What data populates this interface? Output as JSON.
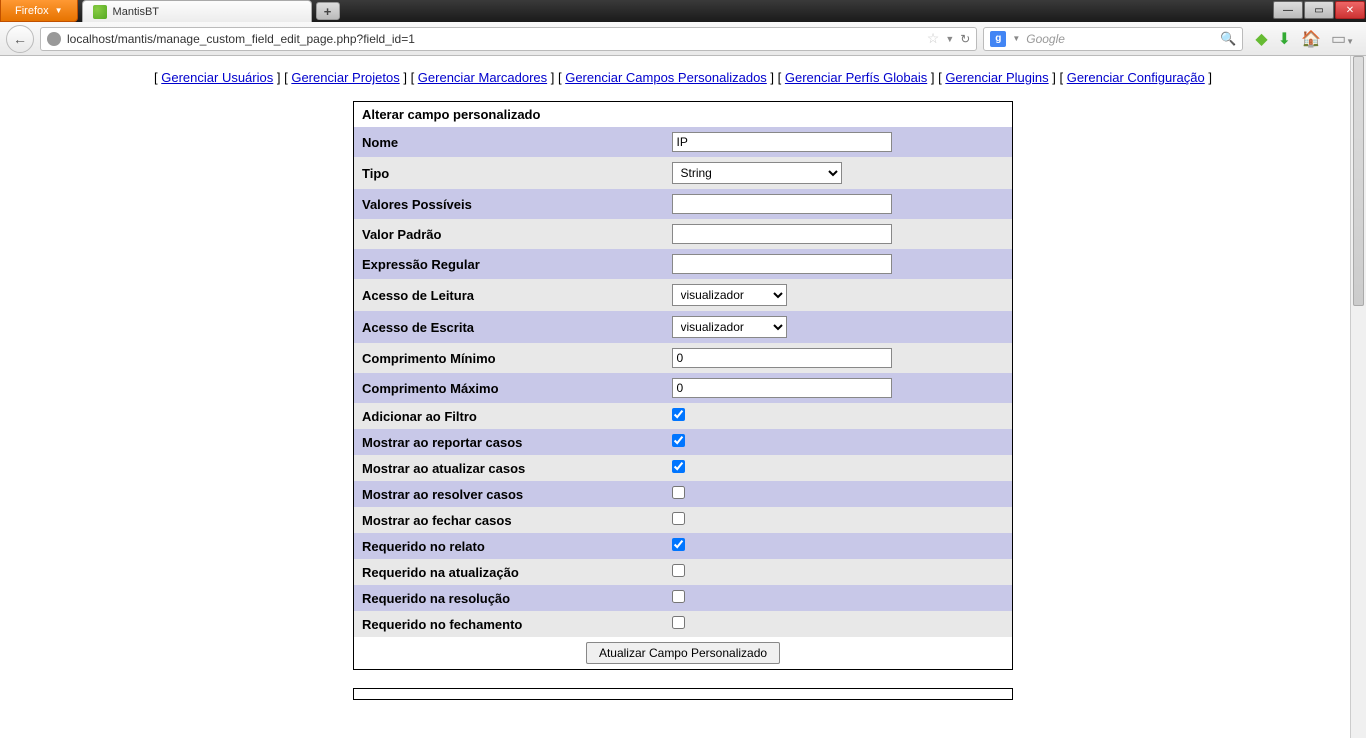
{
  "browser": {
    "product": "Firefox",
    "tab_title": "MantisBT",
    "url": "localhost/mantis/manage_custom_field_edit_page.php?field_id=1",
    "search_placeholder": "Google"
  },
  "nav": {
    "l1": "Gerenciar Usuários",
    "l2": "Gerenciar Projetos",
    "l3": "Gerenciar Marcadores",
    "l4": "Gerenciar Campos Personalizados",
    "l5": "Gerenciar Perfís Globais",
    "l6": "Gerenciar Plugins",
    "l7": "Gerenciar Configuração"
  },
  "form": {
    "title": "Alterar campo personalizado",
    "labels": {
      "nome": "Nome",
      "tipo": "Tipo",
      "valores": "Valores Possíveis",
      "padrao": "Valor Padrão",
      "regex": "Expressão Regular",
      "leitura": "Acesso de Leitura",
      "escrita": "Acesso de Escrita",
      "min": "Comprimento Mínimo",
      "max": "Comprimento Máximo",
      "filtro": "Adicionar ao Filtro",
      "reportar": "Mostrar ao reportar casos",
      "atualizar": "Mostrar ao atualizar casos",
      "resolver": "Mostrar ao resolver casos",
      "fechar": "Mostrar ao fechar casos",
      "req_relato": "Requerido no relato",
      "req_atual": "Requerido na atualização",
      "req_resol": "Requerido na resolução",
      "req_fech": "Requerido no fechamento"
    },
    "values": {
      "nome": "IP",
      "tipo": "String",
      "valores": "",
      "padrao": "",
      "regex": "",
      "leitura": "visualizador",
      "escrita": "visualizador",
      "min": "0",
      "max": "0"
    },
    "checks": {
      "filtro": true,
      "reportar": true,
      "atualizar": true,
      "resolver": false,
      "fechar": false,
      "req_relato": true,
      "req_atual": false,
      "req_resol": false,
      "req_fech": false
    },
    "submit": "Atualizar Campo Personalizado"
  }
}
